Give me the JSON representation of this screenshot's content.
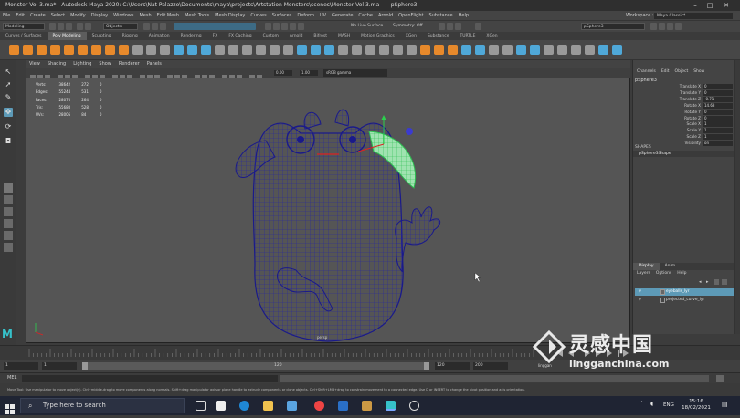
{
  "window": {
    "title": "Monster Vol 3.ma* - Autodesk Maya 2020: C:\\Users\\Nat Palazzo\\Documents\\maya\\projects\\Artstation Monsters\\scenes\\Monster Vol 3.ma  ----  pSphere3"
  },
  "menubar": {
    "items": [
      "File",
      "Edit",
      "Create",
      "Select",
      "Modify",
      "Display",
      "Windows",
      "Mesh",
      "Edit Mesh",
      "Mesh Tools",
      "Mesh Display",
      "Curves",
      "Surfaces",
      "Deform",
      "UV",
      "Generate",
      "Cache",
      "Arnold",
      "OpenFlight",
      "Substance",
      "Help"
    ],
    "workspace_label": "Workspace :",
    "workspace_value": "Maya Classic*"
  },
  "statusline": {
    "mode": "Modeling",
    "select_mode": "Objects",
    "live_surface": "No Live Surface",
    "symmetry": "Symmetry: Off",
    "object_field": "pSphere3"
  },
  "shelf": {
    "tabs": [
      "Curves / Surfaces",
      "Poly Modeling",
      "Sculpting",
      "Rigging",
      "Animation",
      "Rendering",
      "FX",
      "FX Caching",
      "Custom",
      "Arnold",
      "Bifrost",
      "MASH",
      "Motion Graphics",
      "XGen",
      "Substance",
      "TURTLE",
      "XGen"
    ],
    "active_tab": "Poly Modeling"
  },
  "panel": {
    "menu": [
      "View",
      "Shading",
      "Lighting",
      "Show",
      "Renderer",
      "Panels"
    ],
    "field1": "0.00",
    "field2": "1.00",
    "color_space": "sRGB gamma"
  },
  "hud": {
    "rows": [
      {
        "label": "Verts:",
        "v1": "38642",
        "v2": "272",
        "v3": "0"
      },
      {
        "label": "Edges:",
        "v1": "55244",
        "v2": "531",
        "v3": "0"
      },
      {
        "label": "Faces:",
        "v1": "28070",
        "v2": "264",
        "v3": "0"
      },
      {
        "label": "Tris:",
        "v1": "55680",
        "v2": "528",
        "v3": "0"
      },
      {
        "label": "UVs:",
        "v1": "28005",
        "v2": "84",
        "v3": "0"
      }
    ],
    "camera": "persp"
  },
  "channelbox": {
    "menu": [
      "Channels",
      "Edit",
      "Object",
      "Show"
    ],
    "object": "pSphere3",
    "attrs": [
      {
        "name": "Translate X",
        "value": "0"
      },
      {
        "name": "Translate Y",
        "value": "0"
      },
      {
        "name": "Translate Z",
        "value": "-0.71"
      },
      {
        "name": "Rotate X",
        "value": "14.68"
      },
      {
        "name": "Rotate Y",
        "value": "0"
      },
      {
        "name": "Rotate Z",
        "value": "0"
      },
      {
        "name": "Scale X",
        "value": "1"
      },
      {
        "name": "Scale Y",
        "value": "1"
      },
      {
        "name": "Scale Z",
        "value": "1"
      },
      {
        "name": "Visibility",
        "value": "on"
      }
    ],
    "shapes_header": "SHAPES",
    "shape_name": "pSphere3Shape"
  },
  "layers": {
    "tabs": [
      "Display",
      "Anim"
    ],
    "active_tab": "Display",
    "menu": [
      "Layers",
      "Options",
      "Help"
    ],
    "items": [
      {
        "name": "eyeballs_lyr",
        "selected": true
      },
      {
        "name": "projected_curve_lyr",
        "selected": false
      }
    ]
  },
  "range": {
    "start": "1",
    "start2": "1",
    "slider_label": "120",
    "end": "120",
    "end2": "200"
  },
  "cmd": {
    "label": "MEL"
  },
  "help_text": "Move Tool: Use manipulator to move object(s). Ctrl+middle-drag to move components along normals. Shift+drag manipulator axis or plane handle to extrude components or clone objects. Ctrl+Shift+LMB+drag to constrain movement to a connected edge. Use D or INSERT to change the pivot position and axis orientation.",
  "taskbar": {
    "search_placeholder": "Type here to search",
    "time": "15:16",
    "date": "18/02/2021",
    "lang": "ENG"
  },
  "watermark": {
    "brand": "灵感中国",
    "site": "lingganchina.com",
    "sub": "linggan"
  },
  "colors": {
    "selection": "#5d9ab7",
    "mesh_wire": "#1a1a8a",
    "highlight_green": "#3dd66a",
    "taskbar": "#1f2433"
  }
}
